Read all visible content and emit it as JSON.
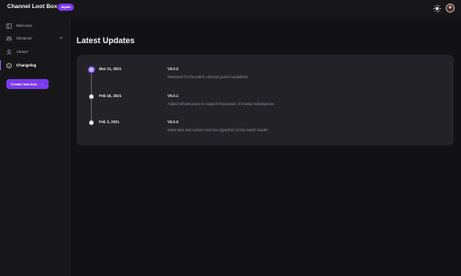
{
  "app": {
    "title": "Channel Loot Box",
    "badge": "alpha"
  },
  "colors": {
    "accent": "#7c3aed",
    "background": "#121214",
    "card": "#222227"
  },
  "header": {
    "theme_icon": "sun-icon",
    "avatar": "user-avatar"
  },
  "sidebar": {
    "items": [
      {
        "label": "Welcome",
        "icon": "sidebar-layout-icon"
      },
      {
        "label": "Streamer",
        "icon": "sliders-icon",
        "expandable": true
      },
      {
        "label": "Viewer",
        "icon": "user-icon"
      },
      {
        "label": "Changelog",
        "icon": "info-icon",
        "active": true
      }
    ],
    "create_button": {
      "label": "Create loot box",
      "arrow": "→"
    }
  },
  "main": {
    "title": "Latest Updates",
    "entries": [
      {
        "date": "Mar 21, 2021",
        "version": "V0.0.2",
        "description": "Released for the twitch channel points hackathon.",
        "current": true
      },
      {
        "date": "Feb 16, 2021",
        "version": "V0.0.1",
        "description": "Added infrastructure to support thousands of reward redemptions.",
        "current": false
      },
      {
        "date": "Feb 3, 2021",
        "version": "V0.0.0",
        "description": "Initial idea and custom loot box algorithm for the twitch model.",
        "current": false
      }
    ]
  }
}
